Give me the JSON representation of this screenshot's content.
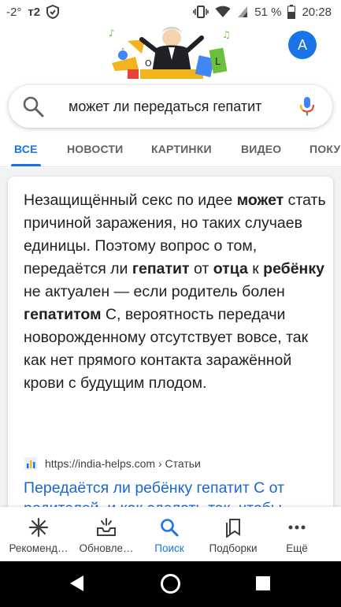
{
  "status_bar": {
    "temperature": "-2°",
    "carrier": "т2",
    "battery": "51 %",
    "time": "20:28"
  },
  "header": {
    "avatar_letter": "A"
  },
  "search": {
    "query": "может ли передаться гепатит"
  },
  "tabs": [
    {
      "label": "ВСЕ"
    },
    {
      "label": "НОВОСТИ"
    },
    {
      "label": "КАРТИНКИ"
    },
    {
      "label": "ВИДЕО"
    },
    {
      "label": "ПОКУ"
    }
  ],
  "snippet": {
    "t1": "Незащищённый секс по идее ",
    "b1": "может",
    "t2": " стать причиной заражения, но таких случаев единицы. Поэтому вопрос о том, передаётся ли ",
    "b2": "гепатит",
    "t3": " от ",
    "b3": "отца",
    "t4": " к ",
    "b4": "ребёнку",
    "t5": " не актуален — если родитель болен ",
    "b5": "гепатитом",
    "t6": " С, вероятность передачи новорожденному отсутствует вовсе, так как нет прямого контакта заражённой крови с будущим плодом."
  },
  "result": {
    "source": "https://india-helps.com › Статьи",
    "title": "Передаётся ли ребёнку гепатит С от родителей, и как сделать так, чтобы"
  },
  "bottom_nav": [
    {
      "label": "Рекоменд…",
      "icon": "asterisk-icon"
    },
    {
      "label": "Обновле…",
      "icon": "inbox-updates-icon"
    },
    {
      "label": "Поиск",
      "icon": "search-icon"
    },
    {
      "label": "Подборки",
      "icon": "collections-icon"
    },
    {
      "label": "Ещё",
      "icon": "more-dots-icon"
    }
  ],
  "colors": {
    "accent": "#1a73e8",
    "link": "#1967d2",
    "text": "#202124"
  }
}
